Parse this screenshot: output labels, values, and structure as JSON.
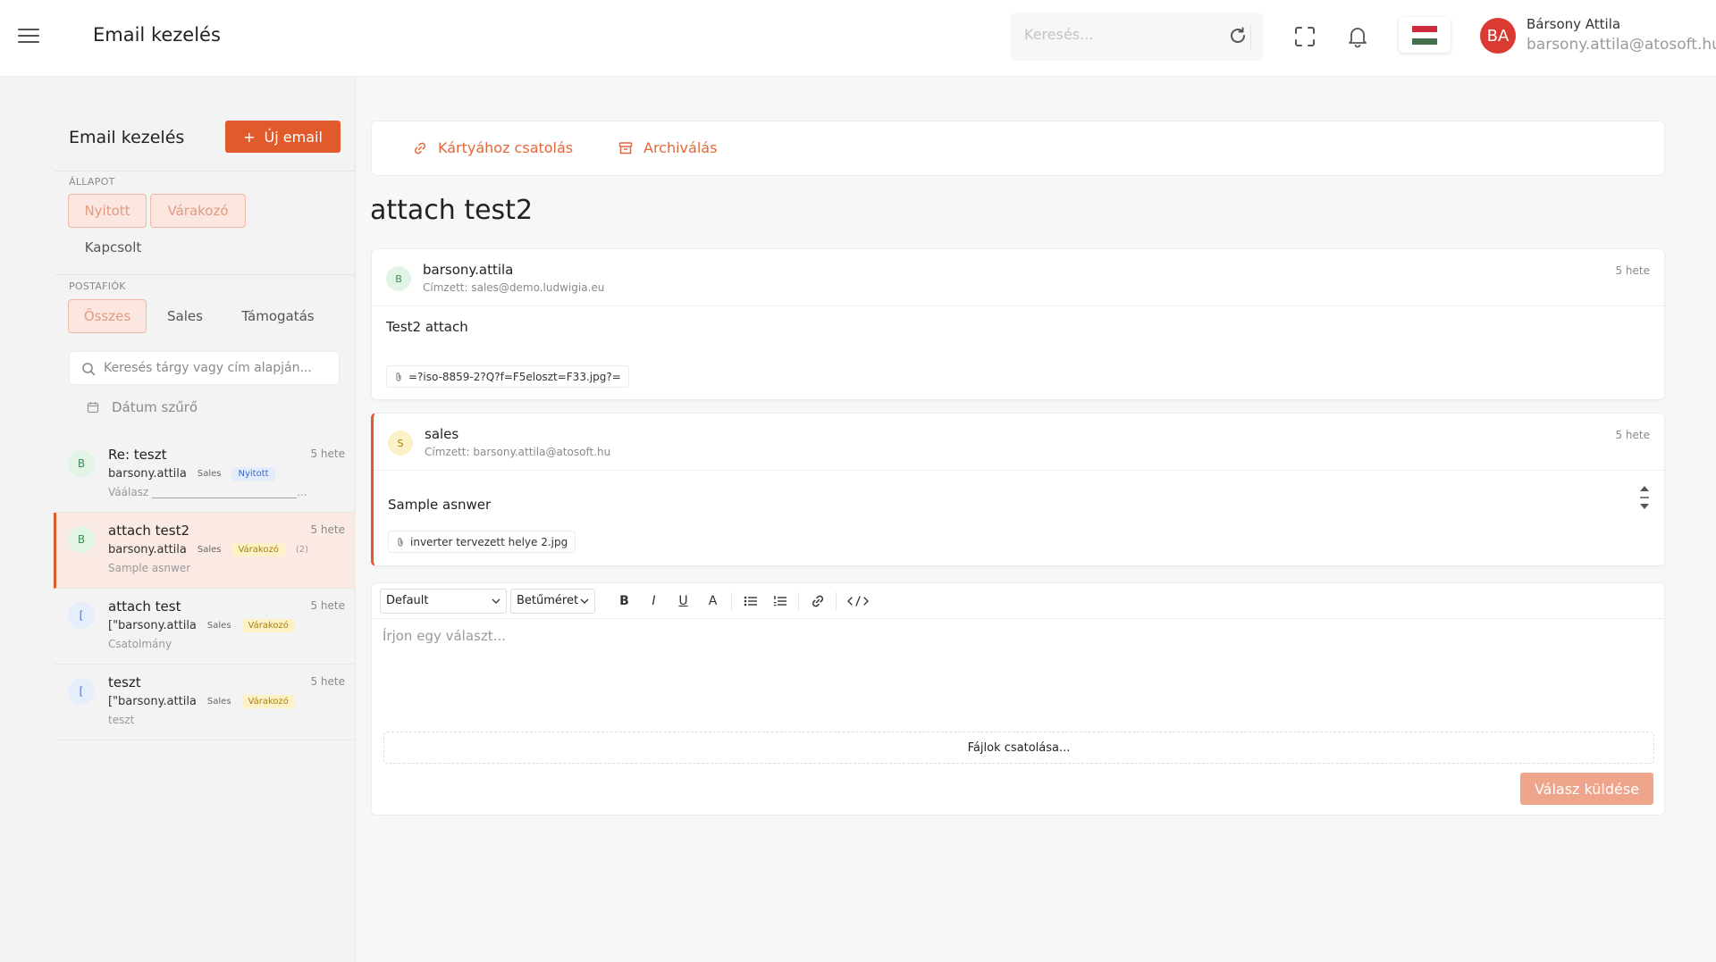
{
  "header": {
    "app_title": "Email kezelés",
    "search_placeholder": "Keresés...",
    "user_initials": "BA",
    "user_name": "Bársony Attila",
    "user_email": "barsony.attila@atosoft.hu",
    "accent_color": "#e05a2b"
  },
  "sidebar": {
    "title": "Email kezelés",
    "new_button_icon": "+",
    "new_button_label": "Új email",
    "status_label": "ÁLLAPOT",
    "status_chips": [
      "Nyitott",
      "Várakozó",
      "Kapcsolt"
    ],
    "mailbox_label": "POSTAFIÓK",
    "mailbox_chips": [
      "Összes",
      "Sales",
      "Támogatás"
    ],
    "search_placeholder": "Keresés tárgy vagy cím alapján...",
    "date_filter_label": "Dátum szűrő",
    "emails": [
      {
        "initial": "B",
        "subject": "Re: teszt",
        "time": "5 hete",
        "from": "barsony.attila",
        "mailbox": "Sales",
        "status": "Nyitott",
        "count": "",
        "preview": "Váálasz ___________________________..."
      },
      {
        "initial": "B",
        "subject": "attach test2",
        "time": "5 hete",
        "from": "barsony.attila",
        "mailbox": "Sales",
        "status": "Várakozó",
        "count": "(2)",
        "preview": "Sample asnwer"
      },
      {
        "initial": "[",
        "subject": "attach test",
        "time": "5 hete",
        "from": "[\"barsony.attila",
        "mailbox": "Sales",
        "status": "Várakozó",
        "count": "",
        "preview": "Csatolmány"
      },
      {
        "initial": "[",
        "subject": "teszt",
        "time": "5 hete",
        "from": "[\"barsony.attila",
        "mailbox": "Sales",
        "status": "Várakozó",
        "count": "",
        "preview": "teszt"
      }
    ]
  },
  "main": {
    "actions": {
      "attach_card": "Kártyához csatolás",
      "archive": "Archiválás"
    },
    "subject": "attach test2",
    "messages": [
      {
        "initial": "B",
        "from": "barsony.attila",
        "to": "Címzett: sales@demo.ludwigia.eu",
        "time": "5 hete",
        "body": "Test2 attach",
        "attachment": "=?iso-8859-2?Q?f=F5eloszt=F33.jpg?="
      },
      {
        "initial": "S",
        "from": "sales",
        "to": "Címzett: barsony.attila@atosoft.hu",
        "time": "5 hete",
        "body": "Sample asnwer",
        "attachment": "inverter tervezett helye 2.jpg"
      }
    ],
    "editor": {
      "font_select": "Default",
      "size_select": "Betűméret",
      "placeholder": "Írjon egy választ...",
      "attach_files": "Fájlok csatolása...",
      "send_button": "Válasz küldése"
    }
  }
}
